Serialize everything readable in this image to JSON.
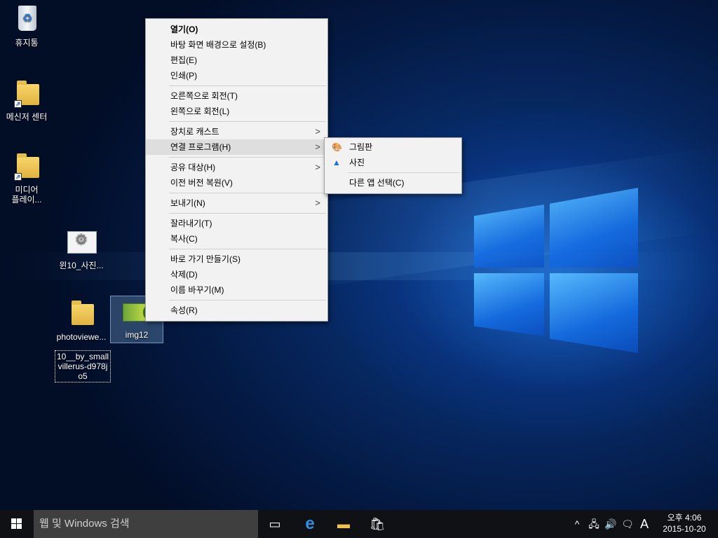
{
  "desktop_icons": [
    {
      "label": "휴지통",
      "icon": "recycle-bin-icon"
    },
    {
      "label": "메신저 센터",
      "icon": "folder-shortcut-icon"
    },
    {
      "label": "미디어\n플레이...",
      "icon": "media-player-shortcut-icon"
    },
    {
      "label": "윈10_사진...",
      "icon": "settings-file-icon"
    },
    {
      "label": "photoviewe...",
      "icon": "folder-icon"
    },
    {
      "label": "img12",
      "icon": "image-file-icon"
    },
    {
      "label": "10__by_small villerus-d978j o5",
      "icon": "renaming-label"
    }
  ],
  "context_menu": {
    "items": [
      {
        "label": "열기(O)",
        "bold": true
      },
      {
        "label": "바탕 화면 배경으로 설정(B)"
      },
      {
        "label": "편집(E)"
      },
      {
        "label": "인쇄(P)"
      },
      {
        "label": "오른쪽으로 회전(T)"
      },
      {
        "label": "왼쪽으로 회전(L)"
      },
      {
        "label": "장치로 캐스트",
        "submenu": true
      },
      {
        "label": "연결 프로그램(H)",
        "submenu": true,
        "highlighted": true
      },
      {
        "label": "공유 대상(H)",
        "submenu": true
      },
      {
        "label": "이전 버전 복원(V)"
      },
      {
        "label": "보내기(N)",
        "submenu": true
      },
      {
        "label": "잘라내기(T)"
      },
      {
        "label": "복사(C)"
      },
      {
        "label": "바로 가기 만들기(S)"
      },
      {
        "label": "삭제(D)"
      },
      {
        "label": "이름 바꾸기(M)"
      },
      {
        "label": "속성(R)"
      }
    ],
    "submenu_arrow": ">"
  },
  "open_with_submenu": {
    "items": [
      {
        "label": "그림판",
        "icon": "paint-icon"
      },
      {
        "label": "사진",
        "icon": "photos-icon"
      },
      {
        "label": "다른 앱 선택(C)"
      }
    ]
  },
  "taskbar": {
    "search_placeholder": "웹 및 Windows 검색",
    "pinned": [
      "task-view-icon",
      "edge-icon",
      "file-explorer-icon",
      "store-icon"
    ],
    "tray": {
      "chevron": "^",
      "ime_label": "A",
      "time": "오후 4:06",
      "date": "2015-10-20"
    }
  }
}
